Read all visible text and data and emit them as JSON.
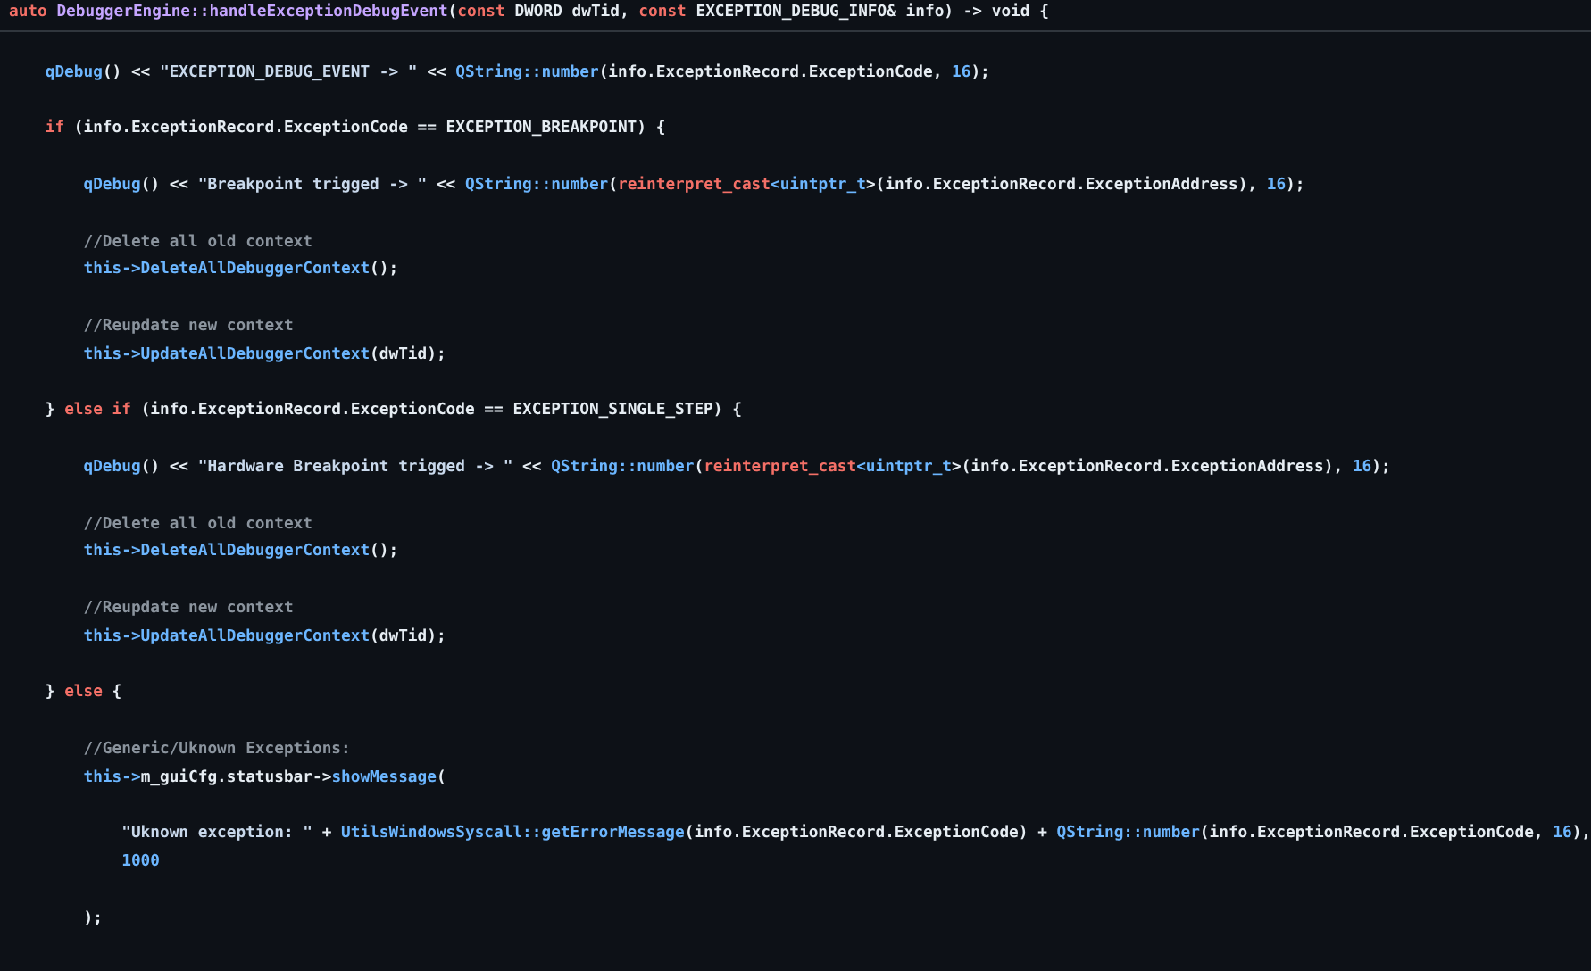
{
  "signature": {
    "tokens": [
      {
        "kind": "kw",
        "text": "auto "
      },
      {
        "kind": "title",
        "text": "DebuggerEngine::handleExceptionDebugEvent"
      },
      {
        "kind": "plain",
        "text": "("
      },
      {
        "kind": "kw",
        "text": "const "
      },
      {
        "kind": "plain",
        "text": "DWORD dwTid, "
      },
      {
        "kind": "kw",
        "text": "const "
      },
      {
        "kind": "plain",
        "text": "EXCEPTION_DEBUG_INFO& info) -> void {"
      }
    ]
  },
  "blocks": [
    {
      "lines": [
        {
          "tokens": [
            {
              "kind": "fn",
              "text": "    qDebug"
            },
            {
              "kind": "plain",
              "text": "() << "
            },
            {
              "kind": "str",
              "text": "\"EXCEPTION_DEBUG_EVENT -> \""
            },
            {
              "kind": "plain",
              "text": " << "
            },
            {
              "kind": "fn",
              "text": "QString::number"
            },
            {
              "kind": "plain",
              "text": "(info.ExceptionRecord.ExceptionCode, "
            },
            {
              "kind": "num",
              "text": "16"
            },
            {
              "kind": "plain",
              "text": ");"
            }
          ]
        }
      ]
    },
    {
      "lines": [
        {
          "tokens": [
            {
              "kind": "kw",
              "text": "    if "
            },
            {
              "kind": "plain",
              "text": "(info.ExceptionRecord.ExceptionCode == EXCEPTION_BREAKPOINT) {"
            }
          ]
        }
      ]
    },
    {
      "lines": [
        {
          "tokens": [
            {
              "kind": "fn",
              "text": "        qDebug"
            },
            {
              "kind": "plain",
              "text": "() << "
            },
            {
              "kind": "str",
              "text": "\"Breakpoint trigged -> \""
            },
            {
              "kind": "plain",
              "text": " << "
            },
            {
              "kind": "fn",
              "text": "QString::number"
            },
            {
              "kind": "plain",
              "text": "("
            },
            {
              "kind": "kw",
              "text": "reinterpret_cast"
            },
            {
              "kind": "fn",
              "text": "<uintptr_t"
            },
            {
              "kind": "plain",
              "text": ">(info.ExceptionRecord.ExceptionAddress), "
            },
            {
              "kind": "num",
              "text": "16"
            },
            {
              "kind": "plain",
              "text": ");"
            }
          ]
        }
      ]
    },
    {
      "lines": [
        {
          "tokens": [
            {
              "kind": "comment",
              "text": "        //Delete all old context"
            }
          ]
        },
        {
          "tokens": [
            {
              "kind": "fn",
              "text": "        this->DeleteAllDebuggerContext"
            },
            {
              "kind": "plain",
              "text": "();"
            }
          ]
        }
      ]
    },
    {
      "lines": [
        {
          "tokens": [
            {
              "kind": "comment",
              "text": "        //Reupdate new context"
            }
          ]
        },
        {
          "tokens": [
            {
              "kind": "fn",
              "text": "        this->UpdateAllDebuggerContext"
            },
            {
              "kind": "plain",
              "text": "(dwTid);"
            }
          ]
        }
      ]
    },
    {
      "lines": [
        {
          "tokens": [
            {
              "kind": "plain",
              "text": "    } "
            },
            {
              "kind": "kw",
              "text": "else if "
            },
            {
              "kind": "plain",
              "text": "(info.ExceptionRecord.ExceptionCode == EXCEPTION_SINGLE_STEP) {"
            }
          ]
        }
      ]
    },
    {
      "lines": [
        {
          "tokens": [
            {
              "kind": "fn",
              "text": "        qDebug"
            },
            {
              "kind": "plain",
              "text": "() << "
            },
            {
              "kind": "str",
              "text": "\"Hardware Breakpoint trigged -> \""
            },
            {
              "kind": "plain",
              "text": " << "
            },
            {
              "kind": "fn",
              "text": "QString::number"
            },
            {
              "kind": "plain",
              "text": "("
            },
            {
              "kind": "kw",
              "text": "reinterpret_cast"
            },
            {
              "kind": "fn",
              "text": "<uintptr_t"
            },
            {
              "kind": "plain",
              "text": ">(info.ExceptionRecord.ExceptionAddress), "
            },
            {
              "kind": "num",
              "text": "16"
            },
            {
              "kind": "plain",
              "text": ");"
            }
          ]
        }
      ]
    },
    {
      "lines": [
        {
          "tokens": [
            {
              "kind": "comment",
              "text": "        //Delete all old context"
            }
          ]
        },
        {
          "tokens": [
            {
              "kind": "fn",
              "text": "        this->DeleteAllDebuggerContext"
            },
            {
              "kind": "plain",
              "text": "();"
            }
          ]
        }
      ]
    },
    {
      "lines": [
        {
          "tokens": [
            {
              "kind": "comment",
              "text": "        //Reupdate new context"
            }
          ]
        },
        {
          "tokens": [
            {
              "kind": "fn",
              "text": "        this->UpdateAllDebuggerContext"
            },
            {
              "kind": "plain",
              "text": "(dwTid);"
            }
          ]
        }
      ]
    },
    {
      "lines": [
        {
          "tokens": [
            {
              "kind": "plain",
              "text": "    } "
            },
            {
              "kind": "kw",
              "text": "else "
            },
            {
              "kind": "plain",
              "text": "{"
            }
          ]
        }
      ]
    },
    {
      "lines": [
        {
          "tokens": [
            {
              "kind": "comment",
              "text": "        //Generic/Uknown Exceptions:"
            }
          ]
        },
        {
          "tokens": [
            {
              "kind": "fn",
              "text": "        this->"
            },
            {
              "kind": "plain",
              "text": "m_guiCfg.statusbar->"
            },
            {
              "kind": "fn",
              "text": "showMessage"
            },
            {
              "kind": "plain",
              "text": "("
            }
          ]
        }
      ]
    },
    {
      "lines": [
        {
          "tokens": [
            {
              "kind": "str",
              "text": "            \"Uknown exception: \""
            },
            {
              "kind": "plain",
              "text": " + "
            },
            {
              "kind": "fn",
              "text": "UtilsWindowsSyscall::getErrorMessage"
            },
            {
              "kind": "plain",
              "text": "(info.ExceptionRecord.ExceptionCode) + "
            },
            {
              "kind": "fn",
              "text": "QString::number"
            },
            {
              "kind": "plain",
              "text": "(info.ExceptionRecord.ExceptionCode, "
            },
            {
              "kind": "num",
              "text": "16"
            },
            {
              "kind": "plain",
              "text": "),"
            }
          ]
        },
        {
          "tokens": [
            {
              "kind": "num",
              "text": "            1000"
            }
          ]
        }
      ]
    },
    {
      "lines": [
        {
          "tokens": [
            {
              "kind": "plain",
              "text": "        );"
            }
          ]
        }
      ]
    }
  ]
}
